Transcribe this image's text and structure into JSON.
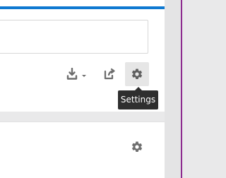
{
  "toolbar": {
    "download_icon": "download-icon",
    "download_dropdown_icon": "chevron-down-icon",
    "share_icon": "share-icon",
    "settings_icon": "gear-icon"
  },
  "tooltip": {
    "label": "Settings"
  },
  "bottom_panel": {
    "settings_icon": "gear-icon"
  },
  "colors": {
    "accent": "#0f79d1",
    "right_border": "#8d2b8f",
    "icon": "#6e6e6e",
    "tooltip_bg": "#2f2f2f"
  }
}
